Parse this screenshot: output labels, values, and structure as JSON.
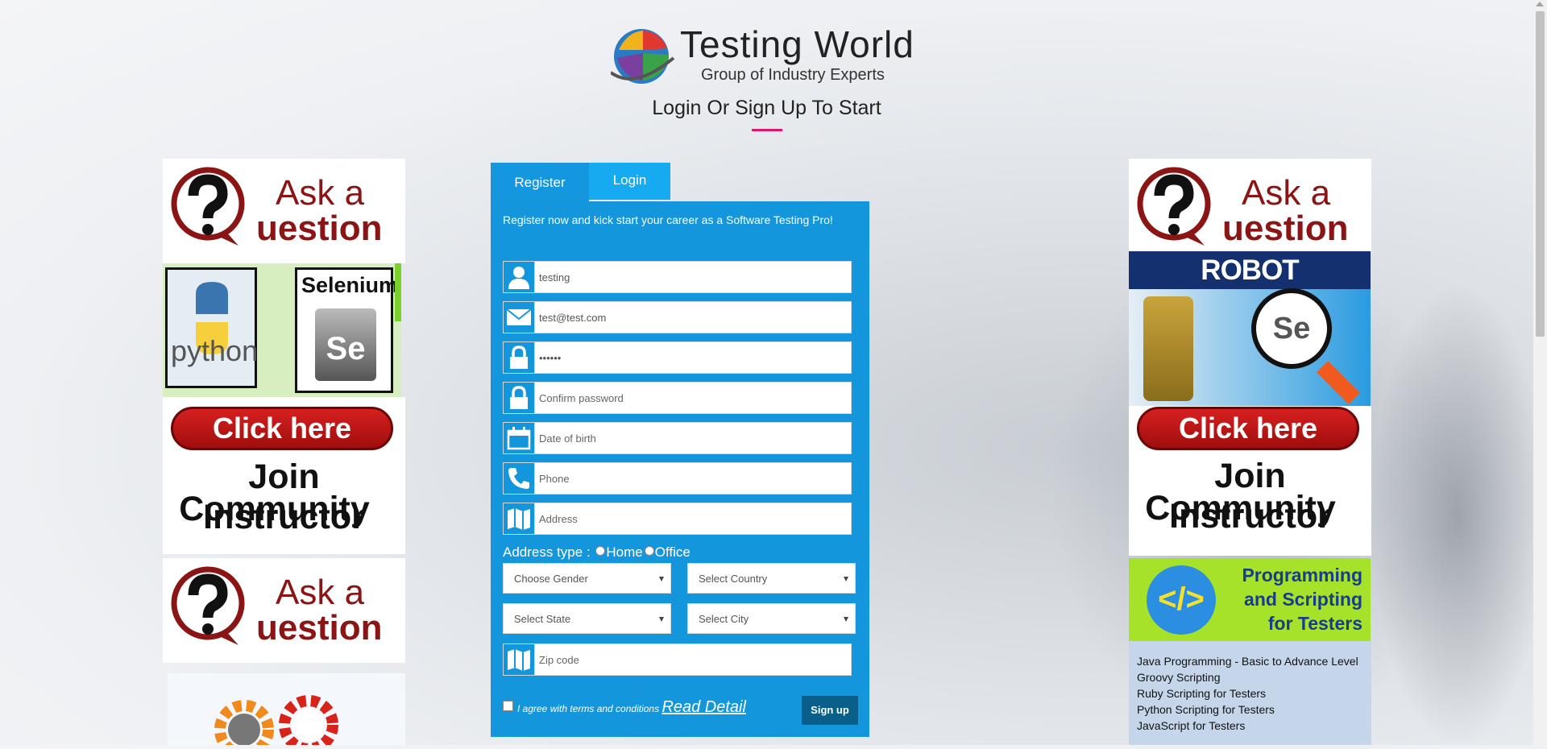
{
  "header": {
    "brand": "Testing World",
    "tagline": "Group of Industry Experts",
    "title": "Login Or Sign Up To Start"
  },
  "tabs": {
    "register": "Register",
    "login": "Login"
  },
  "form": {
    "intro": "Register now and kick start your career as a Software Testing Pro!",
    "username_value": "testing",
    "email_value": "test@test.com",
    "password_value": "••••••",
    "confirm_placeholder": "Confirm password",
    "dob_placeholder": "Date of birth",
    "phone_placeholder": "Phone",
    "address_placeholder": "Address",
    "address_type_label": "Address type :",
    "address_type_home": "Home",
    "address_type_office": "Office",
    "gender_select": "Choose Gender",
    "country_select": "Select Country",
    "state_select": "Select State",
    "city_select": "Select City",
    "zip_placeholder": "Zip code",
    "terms_text": "I agree with terms and conditions",
    "read_detail": "Read Detail",
    "signup": "Sign up"
  },
  "ads_left": {
    "ask_1": "Ask a",
    "ask_2": "uestion",
    "python": "python",
    "selenium": "Selenium",
    "click_here": "Click here",
    "join_1": "Join Instructor",
    "join_2": "Community",
    "ask_3": "Ask a",
    "ask_4": "uestion"
  },
  "ads_right": {
    "ask_1": "Ask a",
    "ask_2": "uestion",
    "robot": "ROBOT FRAMEWORK",
    "click_here": "Click here",
    "join_1": "Join Instructor",
    "join_2": "Community",
    "programming_1": "Programming",
    "programming_2": "and Scripting",
    "programming_3": "for Testers",
    "courses": [
      "Java Programming - Basic to Advance Level",
      "Groovy Scripting",
      "Ruby Scripting for Testers",
      "Python Scripting for Testers",
      "JavaScript for Testers"
    ]
  },
  "colors": {
    "form_blue": "#1396dc",
    "login_tab": "#16aaf0",
    "accent_pink": "#e2156d",
    "signup_button": "#0a5e8a"
  }
}
